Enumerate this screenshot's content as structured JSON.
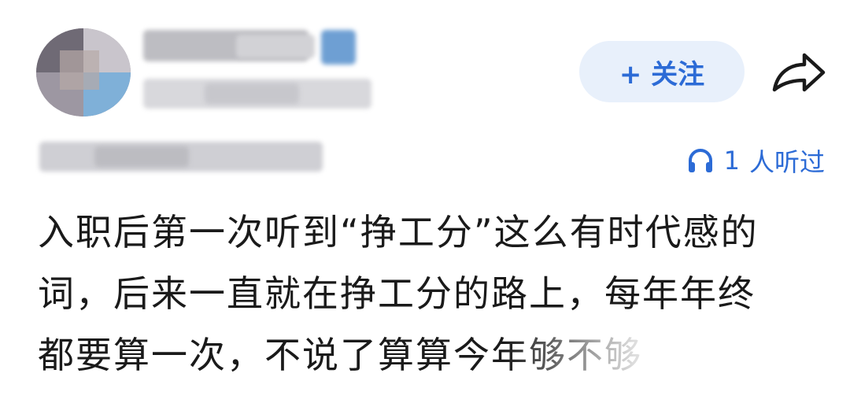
{
  "post": {
    "follow_label": "+ 关注",
    "listen_count": "1",
    "listen_suffix": "人听过",
    "content_lines": [
      "入职后第一次听到“挣工分”这么有时代感的",
      "词，后来一直就在挣工分的路上，每年年终",
      "都要算一次，不说了算算今年够不够"
    ]
  },
  "icons": {
    "share": "share-icon",
    "headphone": "headphone-icon"
  },
  "colors": {
    "accent": "#2c6bd6",
    "follow_bg": "#e8f0fb",
    "text": "#1a1a1a"
  }
}
